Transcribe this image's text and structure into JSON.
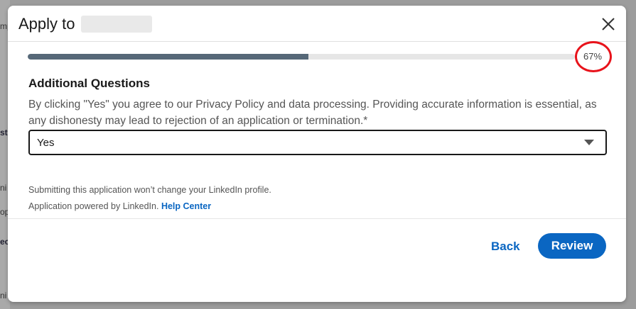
{
  "modal": {
    "title": "Apply to",
    "close_icon": "close-icon"
  },
  "progress": {
    "percent": 67,
    "label": "67%",
    "annotation_color": "#e8131b"
  },
  "question": {
    "section_title": "Additional Questions",
    "text": "By clicking \"Yes\" you agree to our Privacy Policy and data processing. Providing accurate information is essential, as any dishonesty may lead to rejection of an application or termination.*",
    "selected_value": "Yes"
  },
  "footer": {
    "note": "Submitting this application won’t change your LinkedIn profile.",
    "powered_by": "Application powered by LinkedIn.",
    "help_link": "Help Center"
  },
  "actions": {
    "back_label": "Back",
    "review_label": "Review"
  },
  "colors": {
    "accent": "#0a66c2",
    "progress_fill": "#566878"
  },
  "background_fragments": [
    "mp",
    "st",
    "ni",
    "op",
    "ec",
    "ni"
  ]
}
